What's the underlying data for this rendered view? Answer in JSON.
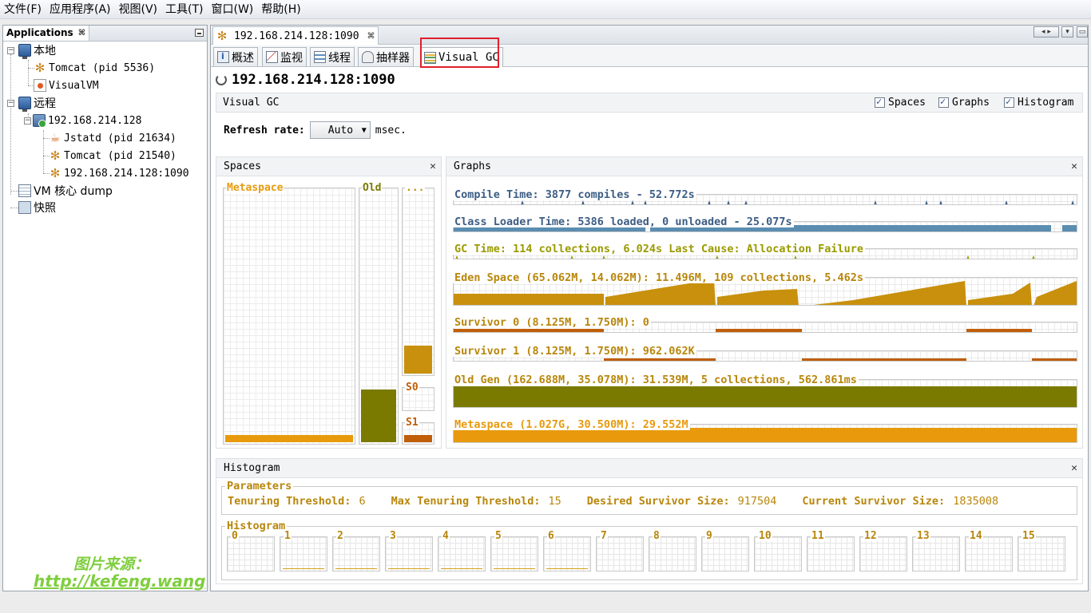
{
  "menu": [
    "文件(F)",
    "应用程序(A)",
    "视图(V)",
    "工具(T)",
    "窗口(W)",
    "帮助(H)"
  ],
  "left_panel": {
    "tab_label": "Applications",
    "tree": {
      "local_label": "本地",
      "local_tomcat": "Tomcat (pid 5536)",
      "local_visualvm": "VisualVM",
      "remote_label": "远程",
      "remote_host": "192.168.214.128",
      "jstatd": "Jstatd (pid 21634)",
      "remote_tomcat": "Tomcat (pid 21540)",
      "jmx": "192.168.214.128:1090",
      "vm_dump": "VM 核心 dump",
      "snapshots": "快照"
    },
    "watermark_line1": "图片来源：",
    "watermark_line2": "http://kefeng.wang"
  },
  "document_tab": "192.168.214.128:1090",
  "subtabs": [
    "概述",
    "监视",
    "线程",
    "抽样器",
    "Visual GC"
  ],
  "header_title": "192.168.214.128:1090",
  "visual_gc": {
    "title": "Visual GC",
    "options": [
      {
        "label": "Spaces",
        "checked": true
      },
      {
        "label": "Graphs",
        "checked": true
      },
      {
        "label": "Histogram",
        "checked": true
      }
    ],
    "refresh_label": "Refresh rate:",
    "refresh_value": "Auto",
    "refresh_unit": "msec."
  },
  "spaces": {
    "title": "Spaces",
    "metaspace_label": "Metaspace",
    "old_label": "Old",
    "eden_label": "...",
    "s0_label": "S0",
    "s1_label": "S1",
    "metaspace_fill": 0.03,
    "old_fill": 0.21,
    "eden_fill": 0.15,
    "s0_fill": 0.0,
    "s1_fill": 0.4
  },
  "graphs": {
    "title": "Graphs",
    "compile": "Compile Time: 3877 compiles - 52.772s",
    "classloader": "Class Loader Time: 5386 loaded, 0 unloaded - 25.077s",
    "gc": "GC Time: 114 collections, 6.024s  Last Cause: Allocation Failure",
    "eden": "Eden Space (65.062M, 14.062M): 11.496M, 109 collections, 5.462s",
    "survivor0": "Survivor 0 (8.125M, 1.750M): 0",
    "survivor1": "Survivor 1 (8.125M, 1.750M): 962.062K",
    "oldgen": "Old Gen (162.688M, 35.078M): 31.539M, 5 collections, 562.861ms",
    "metaspace": "Metaspace (1.027G, 30.500M): 29.552M"
  },
  "colors": {
    "blue_title": "#3c5d84",
    "gold_title": "#b8860b",
    "eden": "#c8900c",
    "survivor": "#c05e0a",
    "oldgen": "#7a7a00",
    "metaspace": "#e89a0c",
    "classloader": "#5b8db0",
    "highlight": "#e0202a"
  },
  "histogram": {
    "title": "Histogram",
    "parameters_title": "Parameters",
    "tenuring_threshold_label": "Tenuring Threshold:",
    "tenuring_threshold": "6",
    "max_tenuring_label": "Max Tenuring Threshold:",
    "max_tenuring": "15",
    "desired_survivor_label": "Desired Survivor Size:",
    "desired_survivor": "917504",
    "current_survivor_label": "Current Survivor Size:",
    "current_survivor": "1835008",
    "histogram_title": "Histogram",
    "buckets": [
      "0",
      "1",
      "2",
      "3",
      "4",
      "5",
      "6",
      "7",
      "8",
      "9",
      "10",
      "11",
      "12",
      "13",
      "14",
      "15"
    ]
  }
}
